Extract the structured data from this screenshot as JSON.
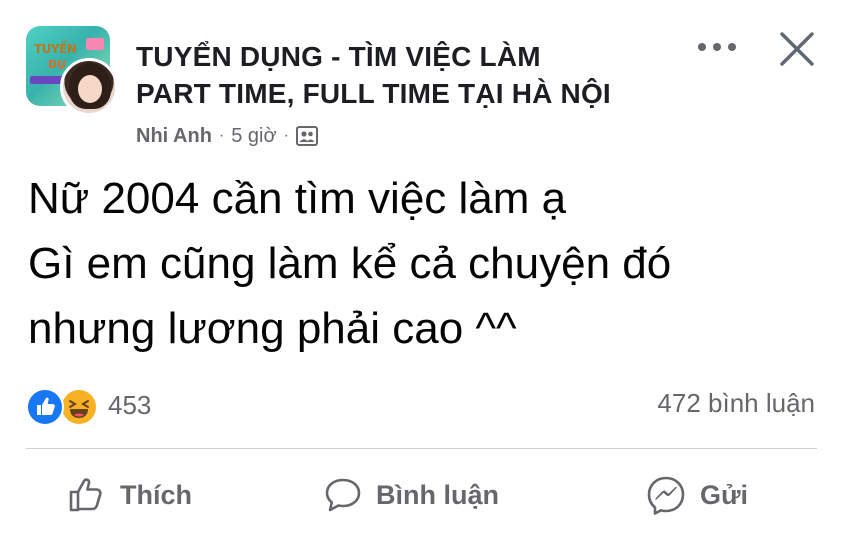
{
  "post": {
    "group_name_line1": "TUYỂN DỤNG - TÌM VIỆC LÀM",
    "group_name_line2": "PART TIME, FULL TIME TẠI HÀ NỘI",
    "group_avatar_text1": "TUYỂN",
    "group_avatar_text2": "DỤ",
    "author": "Nhi Anh",
    "separator": "·",
    "time": "5 giờ",
    "privacy_icon": "group-members-icon",
    "more_icon": "more-horizontal-icon",
    "close_icon": "close-icon",
    "text_lines": [
      "Nữ 2004 cần tìm việc làm ạ",
      "Gì em cũng làm kể cả chuyện đó",
      "nhưng lương phải cao ^^"
    ]
  },
  "stats": {
    "reaction_icons": [
      "like-reaction-icon",
      "haha-reaction-icon"
    ],
    "reaction_count": "453",
    "comment_count": "472 bình luận"
  },
  "actions": {
    "like_label": "Thích",
    "comment_label": "Bình luận",
    "send_label": "Gửi"
  },
  "colors": {
    "like_blue": "#1877f2",
    "haha_yellow": "#f7b125",
    "secondary_text": "#65676b",
    "divider": "#ced0d4"
  }
}
